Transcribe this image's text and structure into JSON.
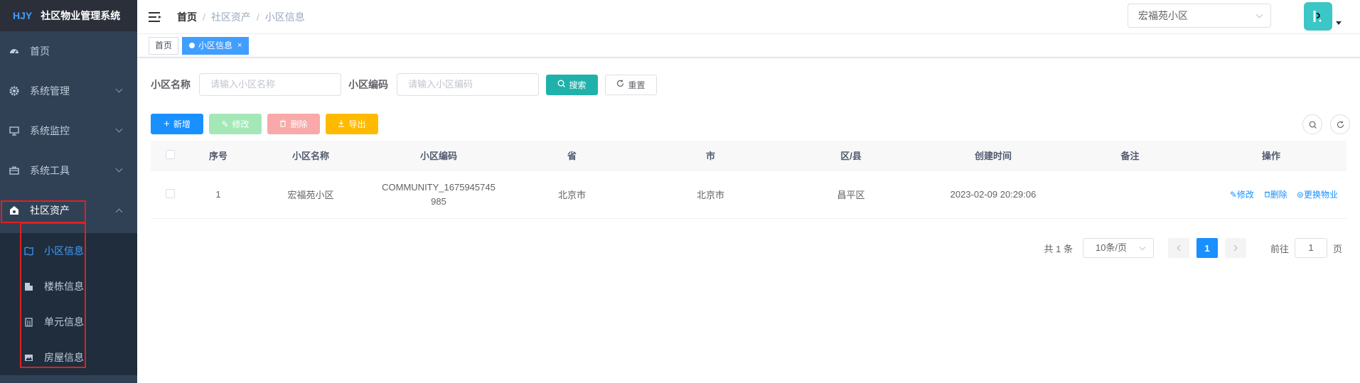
{
  "logo": {
    "brand": "HJY",
    "system_name": "社区物业管理系统"
  },
  "sidebar": {
    "items": [
      {
        "label": "首页",
        "icon": "dashboard-icon"
      },
      {
        "label": "系统管理",
        "icon": "gear-icon"
      },
      {
        "label": "系统监控",
        "icon": "monitor-icon"
      },
      {
        "label": "系统工具",
        "icon": "toolbox-icon"
      },
      {
        "label": "社区资产",
        "icon": "community-icon"
      }
    ],
    "submenu": [
      {
        "label": "小区信息",
        "icon": "map-icon"
      },
      {
        "label": "楼栋信息",
        "icon": "building-icon"
      },
      {
        "label": "单元信息",
        "icon": "unit-icon"
      },
      {
        "label": "房屋信息",
        "icon": "house-image-icon"
      }
    ]
  },
  "header": {
    "breadcrumb": [
      "首页",
      "社区资产",
      "小区信息"
    ],
    "separator": "/",
    "community_select": "宏福苑小区"
  },
  "tags": [
    {
      "label": "首页"
    },
    {
      "label": "小区信息",
      "close": "×"
    }
  ],
  "search": {
    "name_label": "小区名称",
    "name_placeholder": "请输入小区名称",
    "code_label": "小区编码",
    "code_placeholder": "请输入小区编码",
    "search_button": "搜索",
    "reset_button": "重置"
  },
  "toolbar": {
    "add": "新增",
    "edit": "修改",
    "delete": "删除",
    "export": "导出"
  },
  "table": {
    "columns": [
      "序号",
      "小区名称",
      "小区编码",
      "省",
      "市",
      "区/县",
      "创建时间",
      "备注",
      "操作"
    ],
    "rows": [
      {
        "index": "1",
        "name": "宏福苑小区",
        "code_line1": "COMMUNITY_1675945745",
        "code_line2": "985",
        "province": "北京市",
        "city": "北京市",
        "district": "昌平区",
        "created": "2023-02-09 20:29:06",
        "remark": "",
        "actions": [
          "修改",
          "删除",
          "更换物业"
        ]
      }
    ]
  },
  "pagination": {
    "total": "共 1 条",
    "page_size": "10条/页",
    "current_page": "1",
    "goto_label": "前往",
    "goto_value": "1",
    "page_suffix": "页"
  },
  "colors": {
    "sidebar_bg": "#304156",
    "primary": "#1890ff",
    "teal": "#20b2aa",
    "highlight": "#e02020"
  }
}
